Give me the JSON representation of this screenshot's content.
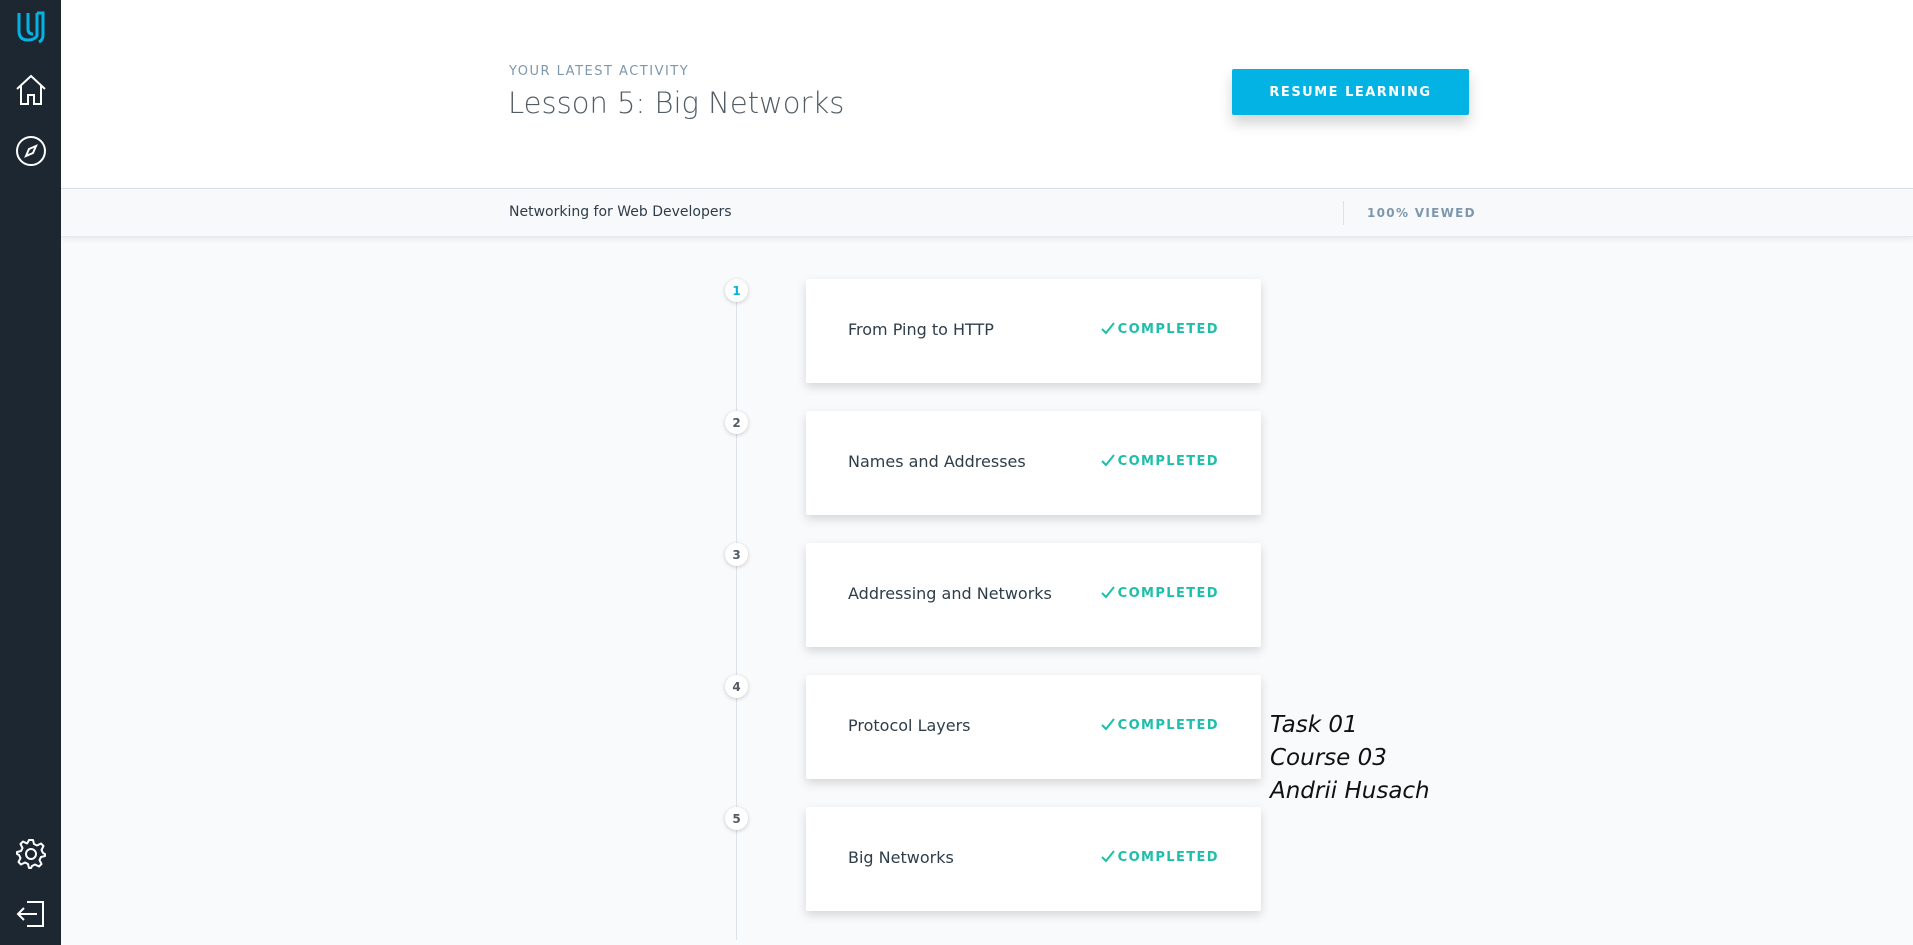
{
  "sidebar": {
    "icons": [
      "udacity-logo-icon",
      "home-icon",
      "compass-icon",
      "gear-icon",
      "logout-icon"
    ]
  },
  "header": {
    "eyebrow": "YOUR LATEST ACTIVITY",
    "title": "Lesson 5: Big Networks",
    "resume_label": "RESUME LEARNING"
  },
  "subbar": {
    "course_name": "Networking for Web Developers",
    "progress_label": "100% VIEWED",
    "progress_percent": 100
  },
  "lessons": [
    {
      "number": "1",
      "title": "From Ping to HTTP",
      "status": "COMPLETED"
    },
    {
      "number": "2",
      "title": "Names and Addresses",
      "status": "COMPLETED"
    },
    {
      "number": "3",
      "title": "Addressing and Networks",
      "status": "COMPLETED"
    },
    {
      "number": "4",
      "title": "Protocol Layers",
      "status": "COMPLETED"
    },
    {
      "number": "5",
      "title": "Big Networks",
      "status": "COMPLETED"
    }
  ],
  "overlay": {
    "line1": "Task 01",
    "line2": "Course 03",
    "line3": "Andrii Husach"
  },
  "colors": {
    "sidebar": "#1d2732",
    "accent": "#02b3e4",
    "completed": "#1dbfaa"
  }
}
